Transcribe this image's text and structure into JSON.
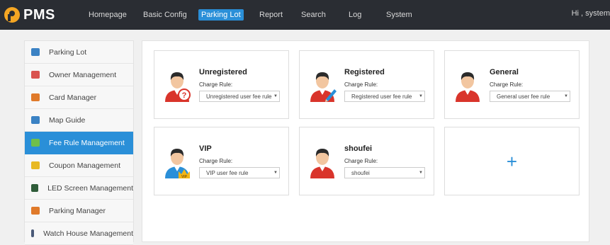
{
  "app": {
    "name": "PMS"
  },
  "nav": {
    "items": [
      {
        "label": "Homepage"
      },
      {
        "label": "Basic Config"
      },
      {
        "label": "Parking Lot"
      },
      {
        "label": "Report"
      },
      {
        "label": "Search"
      },
      {
        "label": "Log"
      },
      {
        "label": "System"
      }
    ],
    "active": "Parking Lot",
    "greeting": "Hi , system"
  },
  "sidebar": {
    "items": [
      {
        "label": "Parking Lot",
        "icon": "parking-lot-icon",
        "color": "#3b82c4"
      },
      {
        "label": "Owner Management",
        "icon": "car-icon",
        "color": "#d9534f"
      },
      {
        "label": "Card Manager",
        "icon": "card-icon",
        "color": "#e07a2a"
      },
      {
        "label": "Map Guide",
        "icon": "map-icon",
        "color": "#3b82c4"
      },
      {
        "label": "Fee Rule Management",
        "icon": "fee-rule-icon",
        "color": "#6fbf4b"
      },
      {
        "label": "Coupon Management",
        "icon": "coupon-icon",
        "color": "#e8b923"
      },
      {
        "label": "LED Screen Management",
        "icon": "led-screen-icon",
        "color": "#2f5d3a"
      },
      {
        "label": "Parking Manager",
        "icon": "person-icon",
        "color": "#e07a2a"
      },
      {
        "label": "Watch House Management",
        "icon": "watch-house-icon",
        "color": "#4a5a78"
      }
    ],
    "active": "Fee Rule Management"
  },
  "cards": [
    {
      "title": "Unregistered",
      "charge_label": "Charge Rule:",
      "value": "Unregistered user fee rule",
      "avatar": "unregistered-user-icon"
    },
    {
      "title": "Registered",
      "charge_label": "Charge Rule:",
      "value": "Registered user fee rule",
      "avatar": "registered-user-icon"
    },
    {
      "title": "General",
      "charge_label": "Charge Rule:",
      "value": "General user fee rule",
      "avatar": "general-user-icon"
    },
    {
      "title": "VIP",
      "charge_label": "Charge Rule:",
      "value": "VIP user fee rule",
      "avatar": "vip-user-icon"
    },
    {
      "title": "shoufei",
      "charge_label": "Charge Rule:",
      "value": "shoufei",
      "avatar": "user-icon"
    }
  ],
  "add_card": {
    "symbol": "+"
  },
  "colors": {
    "topbar": "#2a2d33",
    "accent": "#2a8fd8",
    "avatar_shirt": "#d9342b"
  }
}
